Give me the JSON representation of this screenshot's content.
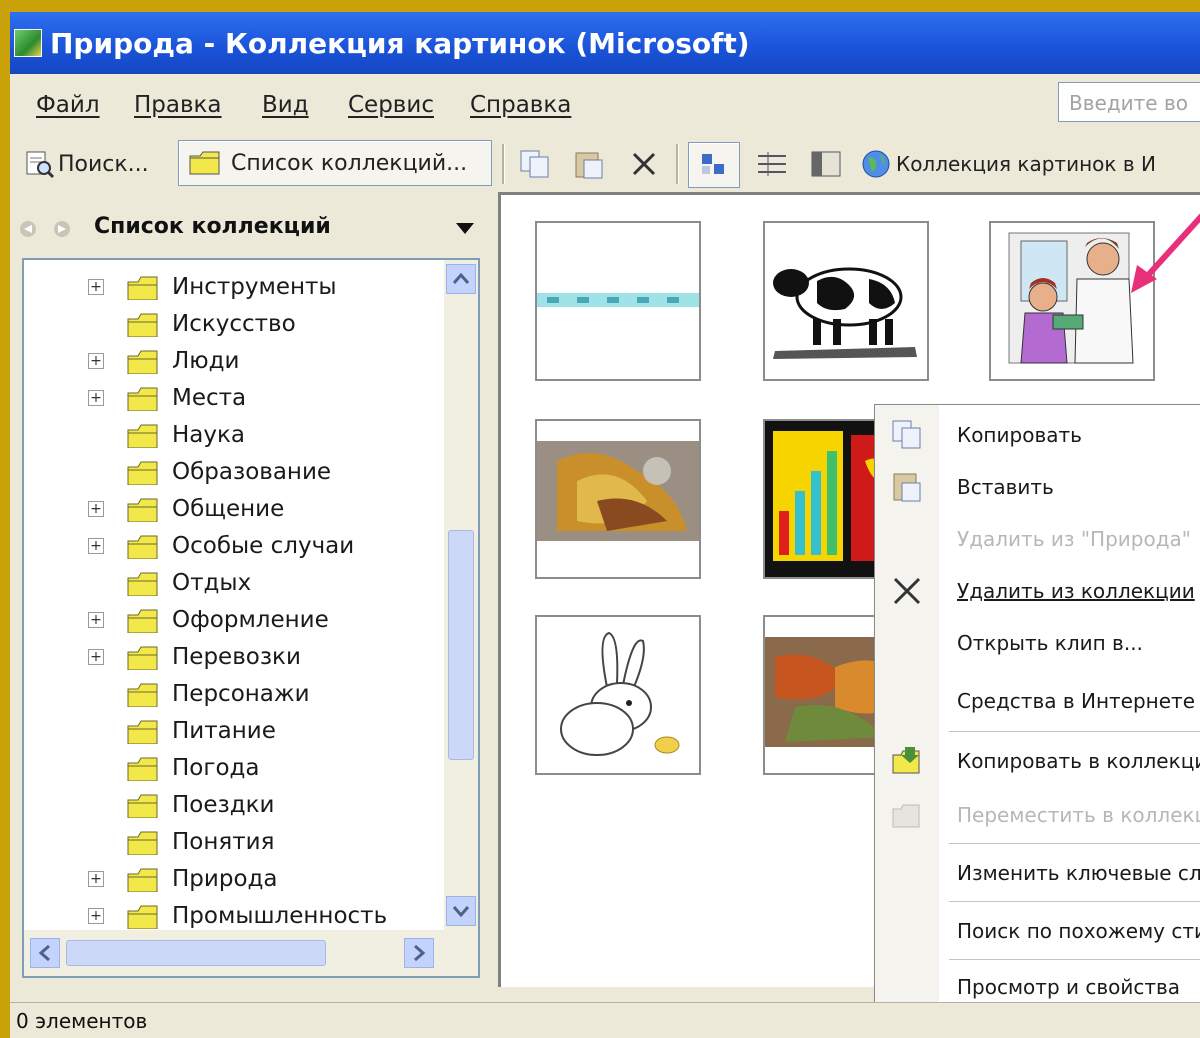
{
  "window": {
    "title": "Природа - Коллекция картинок (Microsoft)"
  },
  "menubar": {
    "items": [
      "Файл",
      "Правка",
      "Вид",
      "Сервис",
      "Справка"
    ],
    "help_search_placeholder": "Введите во"
  },
  "toolbar": {
    "search_label": "Поиск...",
    "collections_label": "Список коллекций...",
    "online_label": "Коллекция картинок в И"
  },
  "taskpane": {
    "title": "Список коллекций"
  },
  "tree": {
    "items": [
      {
        "label": "Инструменты",
        "expandable": true
      },
      {
        "label": "Искусство",
        "expandable": false
      },
      {
        "label": "Люди",
        "expandable": true
      },
      {
        "label": "Места",
        "expandable": true
      },
      {
        "label": "Наука",
        "expandable": false
      },
      {
        "label": "Образование",
        "expandable": false
      },
      {
        "label": "Общение",
        "expandable": true
      },
      {
        "label": "Особые случаи",
        "expandable": true
      },
      {
        "label": "Отдых",
        "expandable": false
      },
      {
        "label": "Оформление",
        "expandable": true
      },
      {
        "label": "Перевозки",
        "expandable": true
      },
      {
        "label": "Персонажи",
        "expandable": false
      },
      {
        "label": "Питание",
        "expandable": false
      },
      {
        "label": "Погода",
        "expandable": false
      },
      {
        "label": "Поездки",
        "expandable": false
      },
      {
        "label": "Понятия",
        "expandable": false
      },
      {
        "label": "Природа",
        "expandable": true
      },
      {
        "label": "Промышленность",
        "expandable": true
      }
    ]
  },
  "context_menu": {
    "items": [
      {
        "label": "Копировать",
        "enabled": true
      },
      {
        "label": "Вставить",
        "enabled": true
      },
      {
        "label": "Удалить из \"Природа\"",
        "enabled": false
      },
      {
        "label": "Удалить из коллекции",
        "enabled": true
      },
      {
        "label": "Открыть клип в...",
        "enabled": true
      },
      {
        "label": "Средства в Интернете",
        "enabled": true
      },
      {
        "label": "Копировать в коллекцию",
        "enabled": true
      },
      {
        "label": "Переместить в коллекцию",
        "enabled": false
      },
      {
        "label": "Изменить ключевые слова",
        "enabled": true
      },
      {
        "label": "Поиск по похожему стилю",
        "enabled": true
      },
      {
        "label": "Просмотр и свойства",
        "enabled": true
      }
    ]
  },
  "statusbar": {
    "text": "0 элементов"
  },
  "colors": {
    "titlebar": "#2f6ff0",
    "folder": "#f2e84a",
    "annotation_arrow": "#e8307a",
    "frame": "#c9a20a"
  }
}
